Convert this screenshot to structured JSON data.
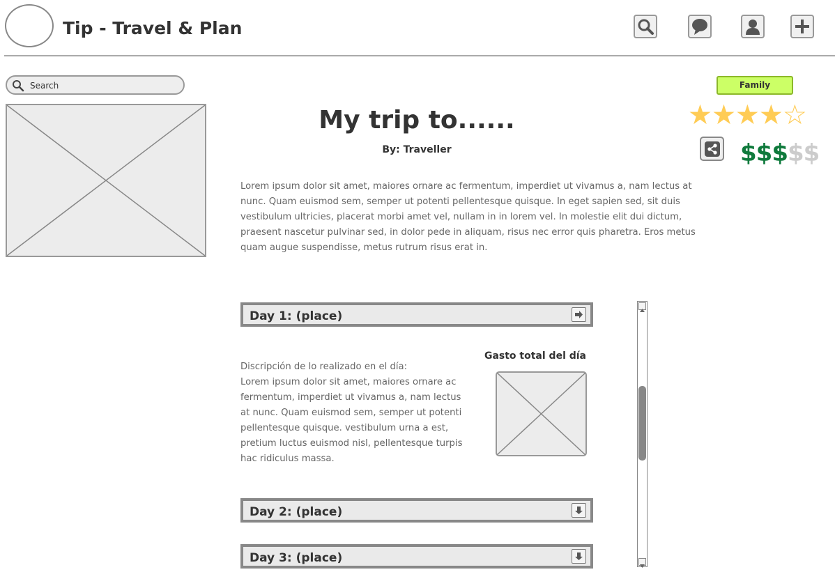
{
  "header": {
    "title": "Tip - Travel & Plan",
    "buttons": [
      {
        "icon": "search-icon"
      },
      {
        "icon": "chat-bubble-icon"
      },
      {
        "icon": "user-icon"
      },
      {
        "icon": "plus-icon"
      }
    ]
  },
  "search": {
    "placeholder": "Search"
  },
  "trip": {
    "title": "My trip to......",
    "author": "By: Traveller",
    "intro": "Lorem ipsum dolor sit amet, maiores ornare ac fermentum, imperdiet ut vivamus a, nam lectus at nunc. Quam euismod sem, semper ut potenti pellentesque quisque. In eget sapien sed, sit duis vestibulum ultricies, placerat morbi amet vel, nullam in in lorem vel. In molestie elit dui dictum, praesent nascetur pulvinar sed, in dolor pede in aliquam, risus nec error quis pharetra. Eros metus quam augue suspendisse, metus rutrum risus erat in."
  },
  "meta": {
    "badge": "Family",
    "rating": 4,
    "rating_max": 5,
    "star_filled": "★★★★",
    "star_empty": "☆",
    "price_level": 3,
    "price_max": 5,
    "price_filled": "$$$",
    "price_empty": "$$",
    "colors": {
      "badge_bg": "#ccff66",
      "star": "#ffcc55",
      "price_on": "#0f7a3c",
      "price_off": "#cccccc"
    }
  },
  "days": [
    {
      "label": "Day 1: (place)",
      "button_icon": "arrow-right-icon"
    },
    {
      "label": "Day 2: (place)",
      "button_icon": "arrow-down-icon"
    },
    {
      "label": "Day 3: (place)",
      "button_icon": "arrow-down-icon"
    }
  ],
  "day1": {
    "desc_heading": "Discripción de lo realizado en el día:",
    "desc_body": "Lorem ipsum dolor sit amet, maiores ornare ac fermentum, imperdiet ut vivamus a, nam lectus at nunc. Quam euismod sem, semper ut potenti pellentesque quisque. vestibulum urna a est, pretium luctus euismod nisl, pellentesque turpis hac ridiculus massa.",
    "gasto_label": "Gasto total del día"
  }
}
